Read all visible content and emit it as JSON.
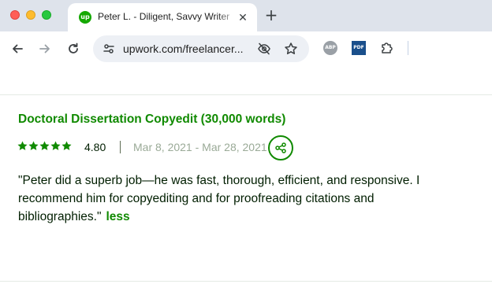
{
  "browser": {
    "tab": {
      "title": "Peter L. - Diligent, Savvy Writer",
      "favicon": "upwork-icon",
      "favicon_text": "up",
      "close_icon": "close-icon"
    },
    "new_tab_icon": "plus-icon",
    "nav": {
      "back_icon": "arrow-left-icon",
      "forward_icon": "arrow-right-icon",
      "reload_icon": "reload-icon"
    },
    "omnibox": {
      "url": "upwork.com/freelancer...",
      "site_info_icon": "tune-icon",
      "privacy_icon": "eye-off-icon",
      "bookmark_icon": "star-outline-icon"
    },
    "extensions": {
      "abp_label": "ABP",
      "pdf_label": "PDF",
      "puzzle_icon": "puzzle-icon"
    }
  },
  "review": {
    "title": "Doctoral Dissertation Copyedit (30,000 words)",
    "stars": 5,
    "rating": "4.80",
    "dates": "Mar 8, 2021 - Mar 28, 2021",
    "share_icon": "share-icon",
    "text": "\"Peter did a superb job—he was fast, thorough, efficient, and responsive. I recommend him for copyediting and for proofreading citations and bibliographies.\"",
    "less_label": "less"
  },
  "colors": {
    "accent": "#108a00",
    "text": "#001e00",
    "muted": "#9aaa97",
    "tabbar": "#dee3eb"
  }
}
